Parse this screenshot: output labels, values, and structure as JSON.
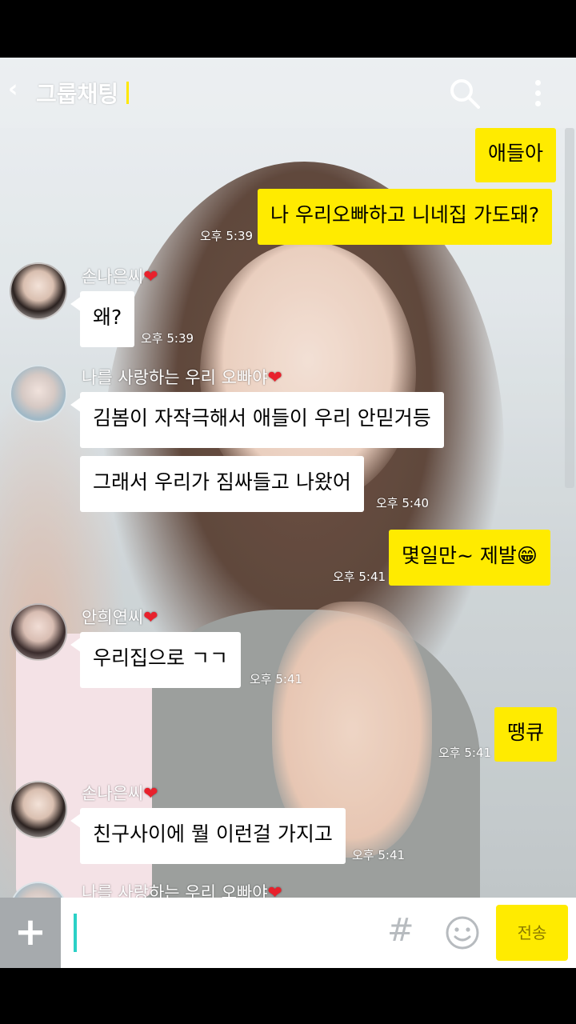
{
  "header": {
    "back_glyph": "‹",
    "title": "그룹채팅",
    "search_icon": "search-icon",
    "menu_icon": "more-vertical-icon"
  },
  "messages": [
    {
      "from": "me",
      "text": "애들아"
    },
    {
      "from": "me",
      "text": "나 우리오빠하고 니네집 가도돼?",
      "time": "오후 5:39"
    },
    {
      "from": "손나은씨",
      "heart": "❤",
      "text": "왜?",
      "time": "오후 5:39"
    },
    {
      "from": "나를 사랑하는 우리 오빠야",
      "heart": "❤",
      "text": "김봄이 자작극해서 애들이 우리 안믿거등"
    },
    {
      "from": "나를 사랑하는 우리 오빠야",
      "text": "그래서 우리가 짐싸들고 나왔어",
      "time": "오후 5:40"
    },
    {
      "from": "me",
      "text": "몇일만~ 제발",
      "emoji": "😁",
      "time": "오후 5:41"
    },
    {
      "from": "안희연씨",
      "heart": "❤",
      "text": "우리집으로 ㄱㄱ",
      "time": "오후 5:41"
    },
    {
      "from": "me",
      "text": "땡큐",
      "time": "오후 5:41"
    },
    {
      "from": "손나은씨",
      "heart": "❤",
      "text": "친구사이에 뭘 이런걸 가지고",
      "time": "오후 5:41"
    },
    {
      "from": "나를 사랑하는 우리 오빠야",
      "heart": "❤"
    }
  ],
  "input": {
    "plus_label": "+",
    "placeholder": "",
    "hash_label": "#",
    "emoji_icon": "smiley-icon",
    "send_label": "전송"
  },
  "colors": {
    "my_bubble": "#ffeb00",
    "other_bubble": "#ffffff",
    "caret": "#2bd1c6",
    "heart": "#e8212c"
  }
}
